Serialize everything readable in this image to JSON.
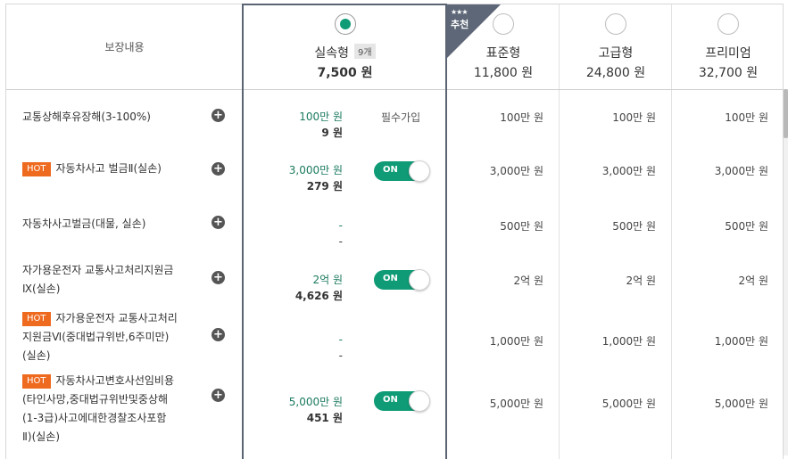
{
  "header": {
    "coverage_label": "보장내용",
    "plans": [
      {
        "name": "실속형",
        "badge": "9개",
        "price": "7,500 원",
        "selected": true
      },
      {
        "name": "표준형",
        "price": "11,800 원",
        "ribbon_stars": "★★★",
        "ribbon_text": "추천"
      },
      {
        "name": "고급형",
        "price": "24,800 원"
      },
      {
        "name": "프리미엄",
        "price": "32,700 원"
      }
    ]
  },
  "rows": [
    {
      "label": "교통상해후유장해(3-100%)",
      "amount": "100만 원",
      "premium": "9 원",
      "required": "필수가입",
      "v1": "100만 원",
      "v2": "100만 원",
      "v3": "100만 원"
    },
    {
      "hot": "HOT",
      "label": "자동차사고 벌금Ⅱ(실손)",
      "amount": "3,000만 원",
      "premium": "279 원",
      "toggle": "ON",
      "v1": "3,000만 원",
      "v2": "3,000만 원",
      "v3": "3,000만 원"
    },
    {
      "label": "자동차사고벌금(대물, 실손)",
      "amount": "-",
      "premium": "-",
      "v1": "500만 원",
      "v2": "500만 원",
      "v3": "500만 원"
    },
    {
      "label_line1": "자가용운전자 교통사고처리지원금",
      "label_line2": "Ⅸ(실손)",
      "amount": "2억 원",
      "premium": "4,626 원",
      "toggle": "ON",
      "v1": "2억 원",
      "v2": "2억 원",
      "v3": "2억 원"
    },
    {
      "hot": "HOT",
      "label_line1": "자가용운전자 교통사고처리",
      "label_line2": "지원금Ⅵ(중대법규위반,6주미만)",
      "label_line3": "(실손)",
      "amount": "-",
      "premium": "-",
      "v1": "1,000만 원",
      "v2": "1,000만 원",
      "v3": "1,000만 원"
    },
    {
      "hot": "HOT",
      "label_line1": "자동차사고변호사선임비용",
      "label_line2": "(타인사망,중대법규위반및중상해",
      "label_line3": "(1-3급)사고에대한경찰조사포함",
      "label_line4": "Ⅱ)(실손)",
      "amount": "5,000만 원",
      "premium": "451 원",
      "toggle": "ON",
      "v1": "5,000만 원",
      "v2": "5,000만 원",
      "v3": "5,000만 원"
    }
  ],
  "colors": {
    "accent": "#0f9b76",
    "hot": "#ee6a1f",
    "ribbon": "#5d6777",
    "selected_border": "#5a6472"
  }
}
